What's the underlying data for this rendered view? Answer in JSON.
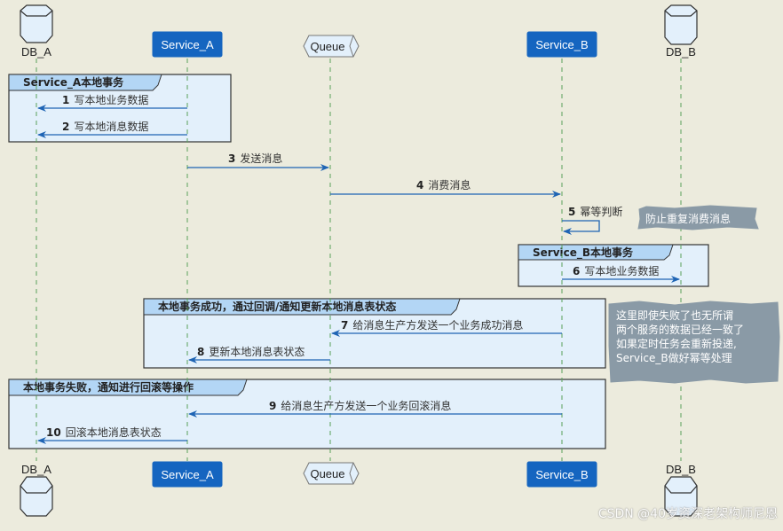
{
  "participants": [
    {
      "id": "db_a",
      "label": "DB_A",
      "type": "database"
    },
    {
      "id": "service_a",
      "label": "Service_A",
      "type": "participant"
    },
    {
      "id": "queue",
      "label": "Queue",
      "type": "queue"
    },
    {
      "id": "service_b",
      "label": "Service_B",
      "type": "participant"
    },
    {
      "id": "db_b",
      "label": "DB_B",
      "type": "database"
    }
  ],
  "groups": [
    {
      "title": "Service_A本地事务"
    },
    {
      "title": "Service_B本地事务"
    },
    {
      "title": "本地事务成功，通过回调/通知更新本地消息表状态"
    },
    {
      "title": "本地事务失败，通知进行回滚等操作"
    }
  ],
  "messages": [
    {
      "num": "1",
      "text": "写本地业务数据",
      "from": "service_a",
      "to": "db_a"
    },
    {
      "num": "2",
      "text": "写本地消息数据",
      "from": "service_a",
      "to": "db_a"
    },
    {
      "num": "3",
      "text": "发送消息",
      "from": "service_a",
      "to": "queue"
    },
    {
      "num": "4",
      "text": "消费消息",
      "from": "queue",
      "to": "service_b"
    },
    {
      "num": "5",
      "text": "幂等判断",
      "from": "service_b",
      "to": "service_b"
    },
    {
      "num": "6",
      "text": "写本地业务数据",
      "from": "service_b",
      "to": "db_b"
    },
    {
      "num": "7",
      "text": "给消息生产方发送一个业务成功消息",
      "from": "service_b",
      "to": "queue"
    },
    {
      "num": "8",
      "text": "更新本地消息表状态",
      "from": "queue",
      "to": "service_a"
    },
    {
      "num": "9",
      "text": "给消息生产方发送一个业务回滚消息",
      "from": "service_b",
      "to": "service_a"
    },
    {
      "num": "10",
      "text": "回滚本地消息表状态",
      "from": "service_a",
      "to": "db_a"
    }
  ],
  "notes": [
    {
      "lines": [
        "防止重复消费消息"
      ]
    },
    {
      "lines": [
        "这里即使失败了也无所谓",
        "两个服务的数据已经一致了",
        "如果定时任务会重新投递,",
        "Service_B做好幂等处理"
      ]
    }
  ],
  "watermark": "CSDN @40岁资深老架构师尼恩",
  "colors": {
    "background": "#ecebdd",
    "participant_fill": "#1565c0",
    "group_fill": "#e3f0fb",
    "group_header_fill": "#b3d6f5",
    "arrow": "#1e64b4",
    "lifeline": "#5aa05a",
    "note_fill": "#8a9aa6"
  }
}
